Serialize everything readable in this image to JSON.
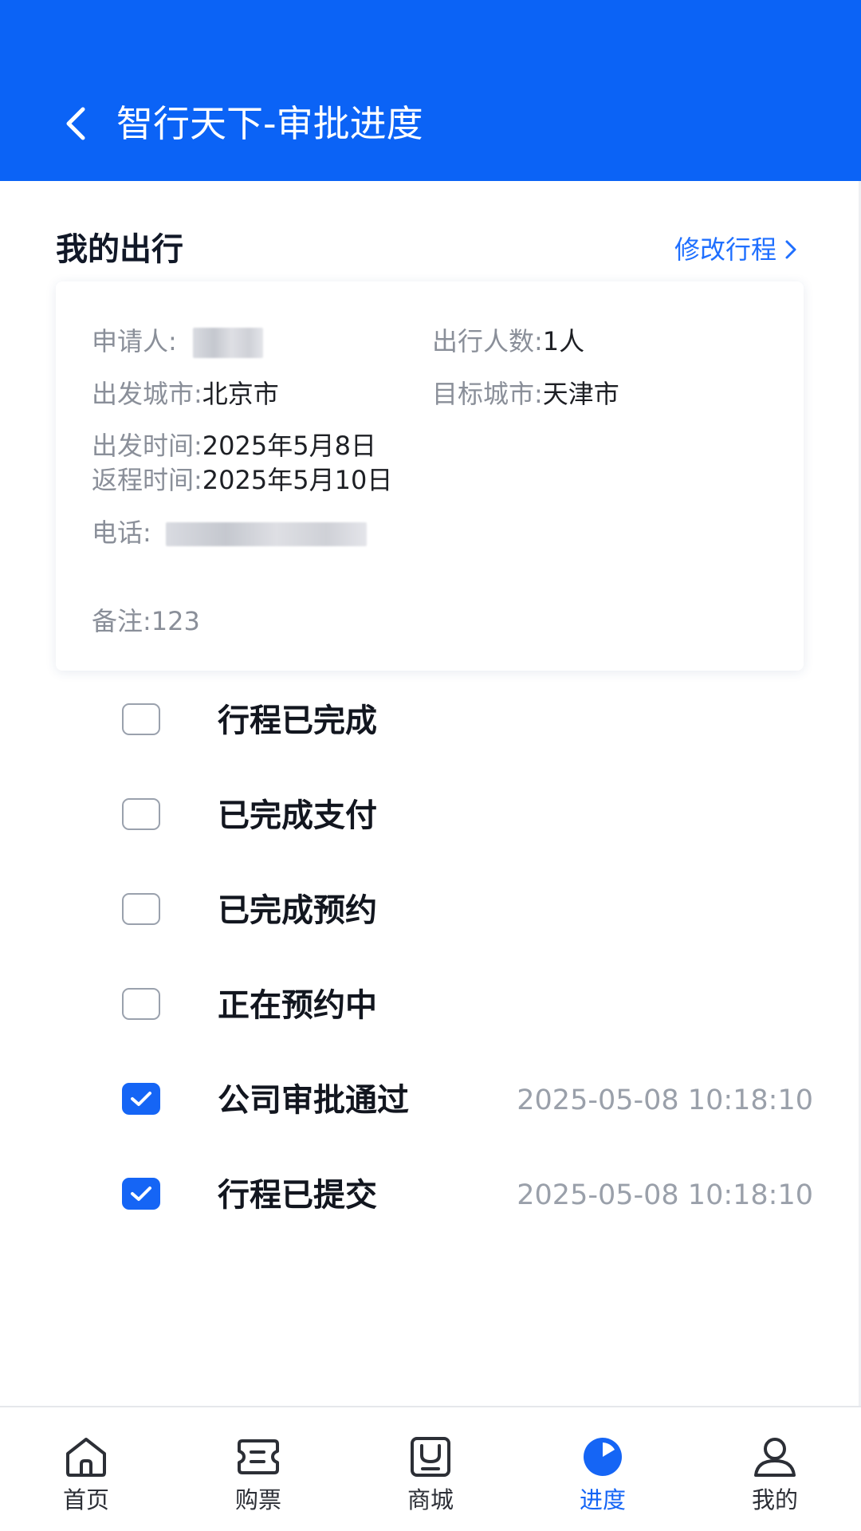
{
  "header": {
    "title": "智行天下-审批进度",
    "back_icon": "chevron-left-icon",
    "color": "#0b63f6"
  },
  "trip": {
    "section_title": "我的出行",
    "edit_link": "修改行程",
    "edit_icon": "chevron-right-icon",
    "applicant_label": "申请人:",
    "travelers_label": "出行人数:",
    "travelers_value": "1人",
    "departure_city_label": "出发城市:",
    "departure_city_value": "北京市",
    "target_city_label": "目标城市:",
    "target_city_value": "天津市",
    "departure_time_label": "出发时间:",
    "departure_time_value": "2025年5月8日",
    "return_time_label": "返程时间:",
    "return_time_value": "2025年5月10日",
    "phone_label": "电话:",
    "remark_label": "备注:",
    "remark_value": "123"
  },
  "progress": {
    "steps": [
      {
        "label": "行程已完成",
        "checked": false,
        "time": ""
      },
      {
        "label": "已完成支付",
        "checked": false,
        "time": ""
      },
      {
        "label": "已完成预约",
        "checked": false,
        "time": ""
      },
      {
        "label": "正在预约中",
        "checked": false,
        "time": ""
      },
      {
        "label": "公司审批通过",
        "checked": true,
        "time": "2025-05-08 10:18:10"
      },
      {
        "label": "行程已提交",
        "checked": true,
        "time": "2025-05-08 10:18:10"
      }
    ],
    "accent_color": "#1565f5"
  },
  "nav": {
    "items": [
      {
        "label": "首页",
        "icon": "home-icon",
        "active": false
      },
      {
        "label": "购票",
        "icon": "ticket-icon",
        "active": false
      },
      {
        "label": "商城",
        "icon": "store-icon",
        "active": false
      },
      {
        "label": "进度",
        "icon": "progress-icon",
        "active": true
      },
      {
        "label": "我的",
        "icon": "user-icon",
        "active": false
      }
    ]
  }
}
